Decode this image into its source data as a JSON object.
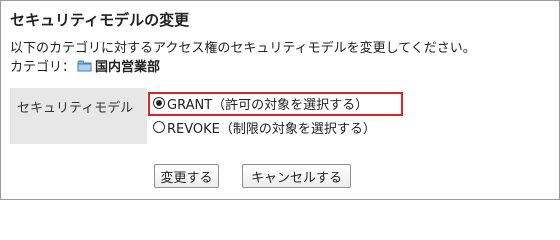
{
  "page": {
    "title": "セキュリティモデルの変更",
    "description": "以下のカテゴリに対するアクセス権のセキュリティモデルを変更してください。",
    "category_label": "カテゴリ：",
    "category_name": "国内営業部",
    "category_icon": "folder-icon"
  },
  "form": {
    "field_label": "セキュリティモデル",
    "options": [
      {
        "label": "GRANT（許可の対象を選択する）",
        "checked": true
      },
      {
        "label": "REVOKE（制限の対象を選択する）",
        "checked": false
      }
    ],
    "highlight_color": "#e02424"
  },
  "buttons": {
    "save_label": "変更する",
    "cancel_label": "キャンセルする"
  }
}
